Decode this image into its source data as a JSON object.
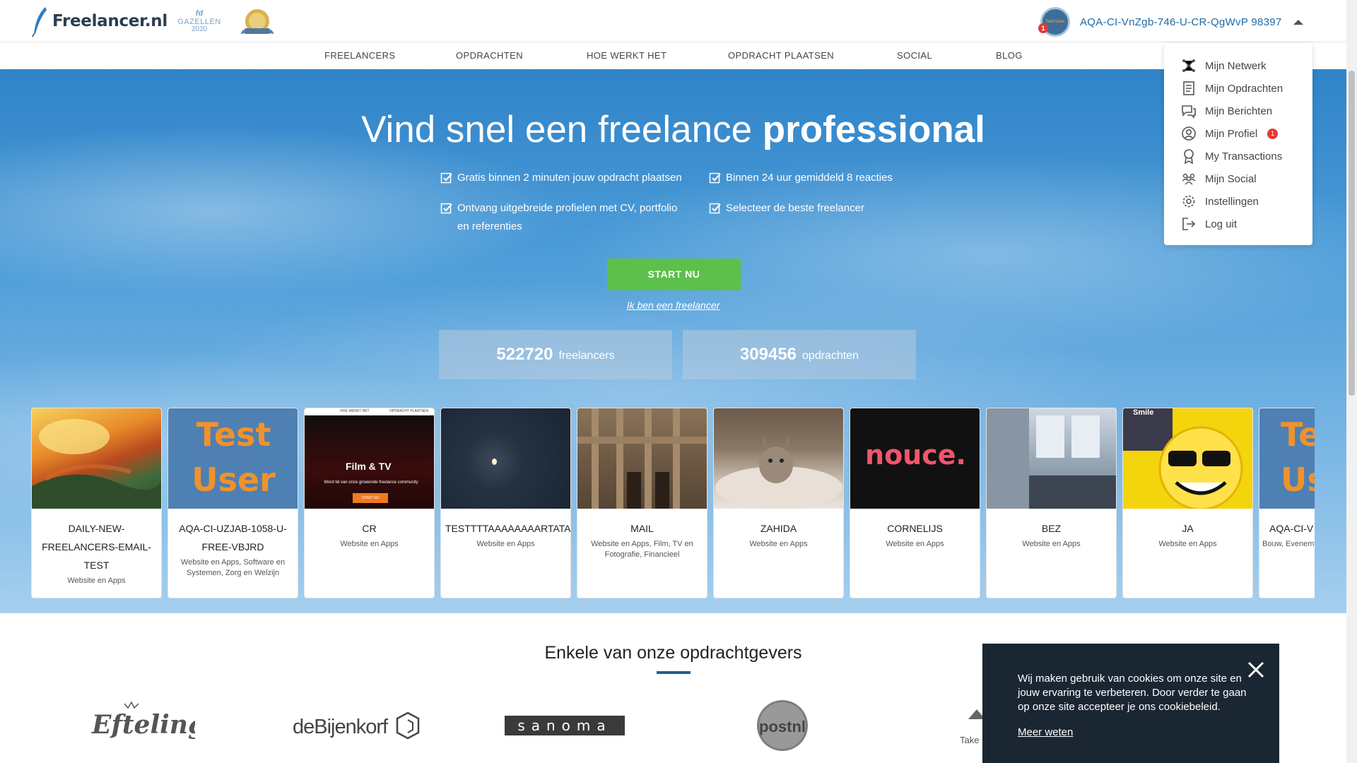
{
  "header": {
    "logo_text": "Freelancer.nl",
    "award1": {
      "line1": "fd",
      "line2": "GAZELLEN",
      "line3": "2020"
    },
    "username": "AQA-CI-VnZgb-746-U-CR-QgWvP 98397",
    "avatar_badge": "1",
    "avatar_mini": "Test User"
  },
  "nav": {
    "items": [
      "FREELANCERS",
      "OPDRACHTEN",
      "HOE WERKT HET",
      "OPDRACHT PLAATSEN",
      "SOCIAL",
      "BLOG"
    ]
  },
  "hero": {
    "title_regular": "Vind snel een freelance ",
    "title_bold": "professional",
    "checks": [
      "Gratis binnen 2 minuten jouw opdracht plaatsen",
      "Binnen 24 uur gemiddeld 8 reacties",
      "Ontvang uitgebreide profielen met CV, portfolio en referenties",
      "Selecteer de beste freelancer"
    ],
    "start_button": "START NU",
    "freelancer_link": "Ik ben een freelancer",
    "stats": [
      {
        "number": "522720",
        "label": "freelancers"
      },
      {
        "number": "309456",
        "label": "opdrachten"
      }
    ]
  },
  "cards": [
    {
      "name": "DAILY-NEW-FREELANCERS-EMAIL-TEST",
      "category": "Website en Apps"
    },
    {
      "name": "AQA-CI-UZJAB-1058-U-FREE-VBJRD",
      "category": "Website en Apps, Software en Systemen, Zorg en Welzijn",
      "image_text": [
        "Test",
        "User"
      ]
    },
    {
      "name": "CR",
      "category": "Website en Apps",
      "image_text": [
        "Film & TV",
        "Word lid van onze groeiende freelance community",
        "START NU",
        "HOE WERKT HET",
        "OPDRACHT PLAATSEN"
      ]
    },
    {
      "name": "TESTTTTAAAAAAAARTATAT",
      "category": "Website en Apps"
    },
    {
      "name": "MAIL",
      "category": "Website en Apps, Film, TV en Fotografie, Financieel"
    },
    {
      "name": "ZAHIDA",
      "category": "Website en Apps"
    },
    {
      "name": "CORNELIJS",
      "category": "Website en Apps",
      "image_text": [
        "nouce."
      ]
    },
    {
      "name": "BEZ",
      "category": "Website en Apps"
    },
    {
      "name": "JA",
      "category": "Website en Apps",
      "image_text": [
        "Smile"
      ]
    },
    {
      "name": "AQA-CI-V",
      "category": "Bouw, Evenem Grafisc",
      "image_text": [
        "Te",
        "Us"
      ]
    }
  ],
  "clients": {
    "title": "Enkele van onze opdrachtgevers",
    "logos": [
      "Efteling",
      "deBijenkorf",
      "sanoma",
      "postnl",
      "Take"
    ]
  },
  "dropdown": {
    "items": [
      {
        "label": "Mijn Netwerk",
        "icon": "network-icon"
      },
      {
        "label": "Mijn Opdrachten",
        "icon": "document-icon"
      },
      {
        "label": "Mijn Berichten",
        "icon": "chat-icon"
      },
      {
        "label": "Mijn Profiel",
        "icon": "profile-icon",
        "badge": "1"
      },
      {
        "label": "My Transactions",
        "icon": "award-icon"
      },
      {
        "label": "Mijn Social",
        "icon": "group-icon"
      },
      {
        "label": "Instellingen",
        "icon": "gear-icon"
      },
      {
        "label": "Log uit",
        "icon": "logout-icon"
      }
    ]
  },
  "cookie": {
    "text": "Wij maken gebruik van cookies om onze site en jouw ervaring te verbeteren. Door verder te gaan op onze site accepteer je ons cookiebeleid.",
    "link": "Meer weten"
  },
  "colors": {
    "brand_blue": "#1e6aa6",
    "start_green": "#5cc04b",
    "cookie_bg": "#1b2633",
    "badge_red": "#e53935"
  }
}
